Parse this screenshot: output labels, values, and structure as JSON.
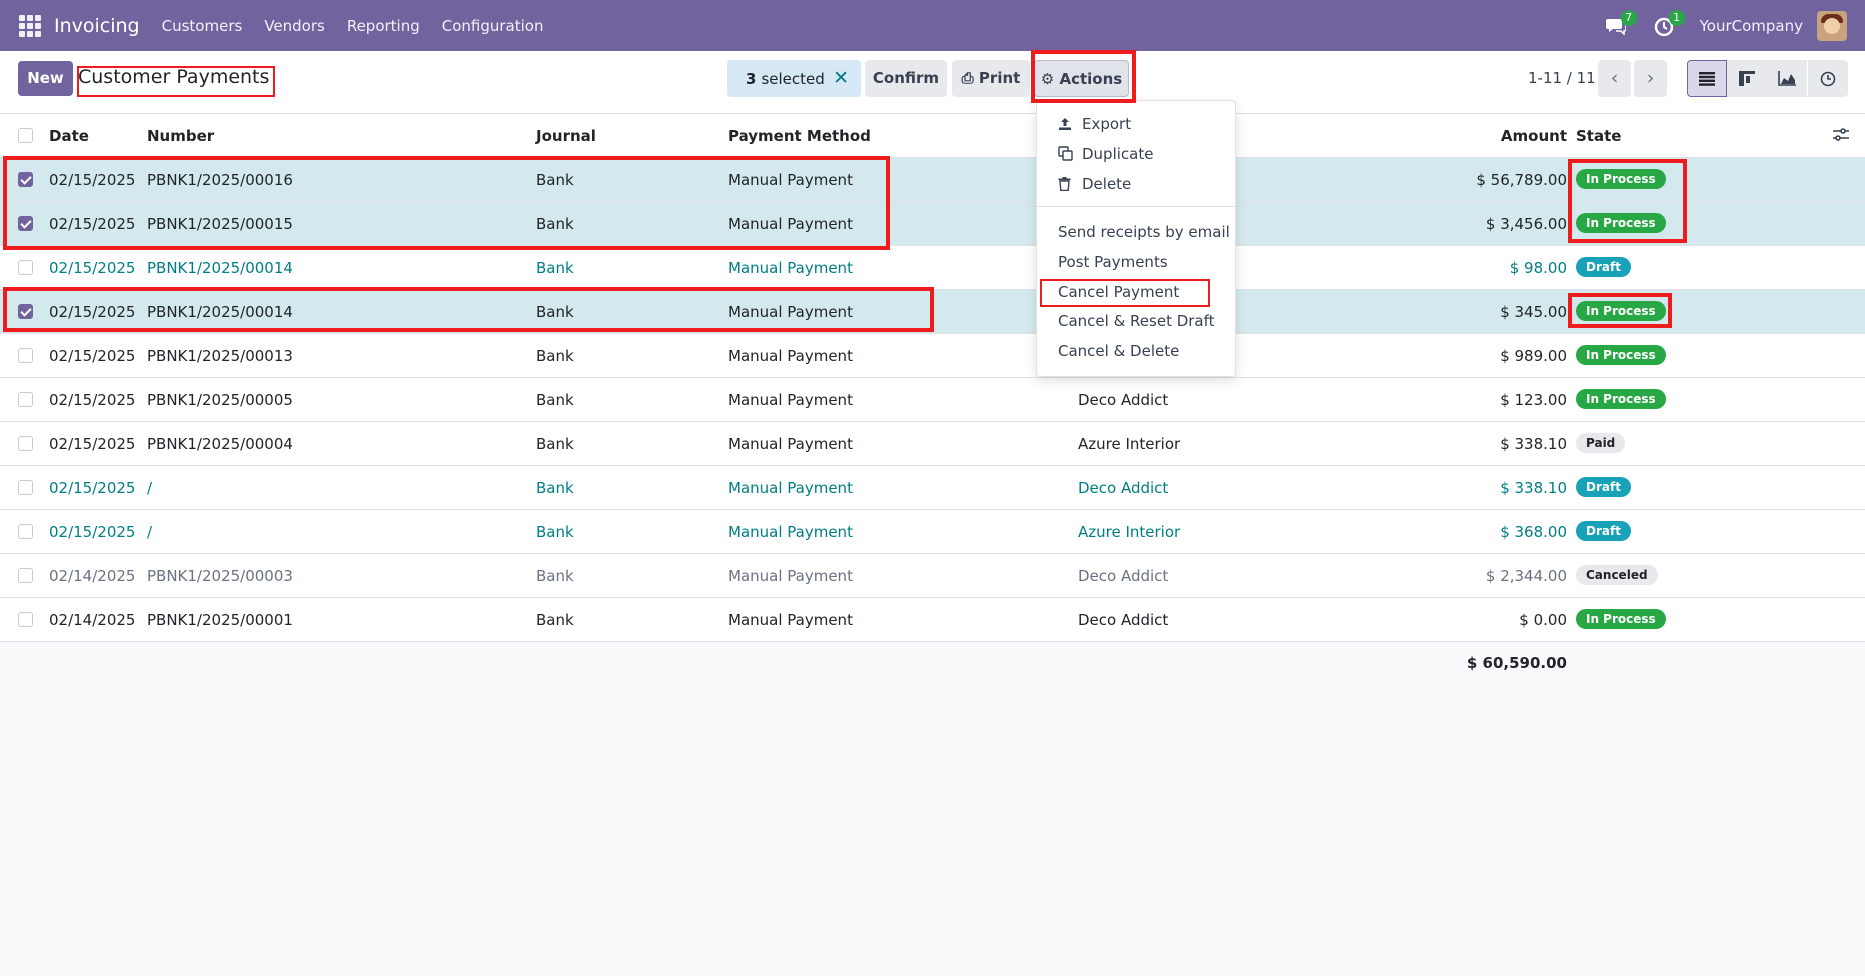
{
  "navbar": {
    "app_name": "Invoicing",
    "menu": [
      "Customers",
      "Vendors",
      "Reporting",
      "Configuration"
    ],
    "messages_count": "7",
    "activities_count": "1",
    "company": "YourCompany"
  },
  "control_panel": {
    "new_label": "New",
    "title": "Customer Payments",
    "selected_count": "3",
    "selected_label": "selected",
    "confirm_label": "Confirm",
    "print_label": "Print",
    "actions_label": "Actions",
    "pager": "1-11 / 11"
  },
  "table": {
    "headers": {
      "date": "Date",
      "number": "Number",
      "journal": "Journal",
      "method": "Payment Method",
      "amount": "Amount",
      "state": "State"
    },
    "rows": [
      {
        "date": "02/15/2025",
        "number": "PBNK1/2025/00016",
        "journal": "Bank",
        "method": "Manual Payment",
        "customer": "",
        "amount": "$ 56,789.00",
        "state": "In Process"
      },
      {
        "date": "02/15/2025",
        "number": "PBNK1/2025/00015",
        "journal": "Bank",
        "method": "Manual Payment",
        "customer": "",
        "amount": "$ 3,456.00",
        "state": "In Process"
      },
      {
        "date": "02/15/2025",
        "number": "PBNK1/2025/00014",
        "journal": "Bank",
        "method": "Manual Payment",
        "customer": "",
        "amount": "$ 98.00",
        "state": "Draft"
      },
      {
        "date": "02/15/2025",
        "number": "PBNK1/2025/00014",
        "journal": "Bank",
        "method": "Manual Payment",
        "customer": "",
        "amount": "$ 345.00",
        "state": "In Process"
      },
      {
        "date": "02/15/2025",
        "number": "PBNK1/2025/00013",
        "journal": "Bank",
        "method": "Manual Payment",
        "customer": "",
        "amount": "$ 989.00",
        "state": "In Process"
      },
      {
        "date": "02/15/2025",
        "number": "PBNK1/2025/00005",
        "journal": "Bank",
        "method": "Manual Payment",
        "customer": "Deco Addict",
        "amount": "$ 123.00",
        "state": "In Process"
      },
      {
        "date": "02/15/2025",
        "number": "PBNK1/2025/00004",
        "journal": "Bank",
        "method": "Manual Payment",
        "customer": "Azure Interior",
        "amount": "$ 338.10",
        "state": "Paid"
      },
      {
        "date": "02/15/2025",
        "number": "/",
        "journal": "Bank",
        "method": "Manual Payment",
        "customer": "Deco Addict",
        "amount": "$ 338.10",
        "state": "Draft"
      },
      {
        "date": "02/15/2025",
        "number": "/",
        "journal": "Bank",
        "method": "Manual Payment",
        "customer": "Azure Interior",
        "amount": "$ 368.00",
        "state": "Draft"
      },
      {
        "date": "02/14/2025",
        "number": "PBNK1/2025/00003",
        "journal": "Bank",
        "method": "Manual Payment",
        "customer": "Deco Addict",
        "amount": "$ 2,344.00",
        "state": "Canceled"
      },
      {
        "date": "02/14/2025",
        "number": "PBNK1/2025/00001",
        "journal": "Bank",
        "method": "Manual Payment",
        "customer": "Deco Addict",
        "amount": "$ 0.00",
        "state": "In Process"
      }
    ],
    "total": "$ 60,590.00"
  },
  "actions_menu": {
    "export": "Export",
    "duplicate": "Duplicate",
    "delete": "Delete",
    "send_receipts": "Send receipts by email",
    "post_payments": "Post Payments",
    "cancel_payment": "Cancel Payment",
    "cancel_reset_draft": "Cancel & Reset Draft",
    "cancel_delete": "Cancel & Delete"
  },
  "colors": {
    "brand": "#71639e",
    "selected_row": "#d3e9ee",
    "in_process": "#28a745",
    "draft": "#17a2b8",
    "link": "#017e84",
    "annotation": "#ee1c1c"
  }
}
